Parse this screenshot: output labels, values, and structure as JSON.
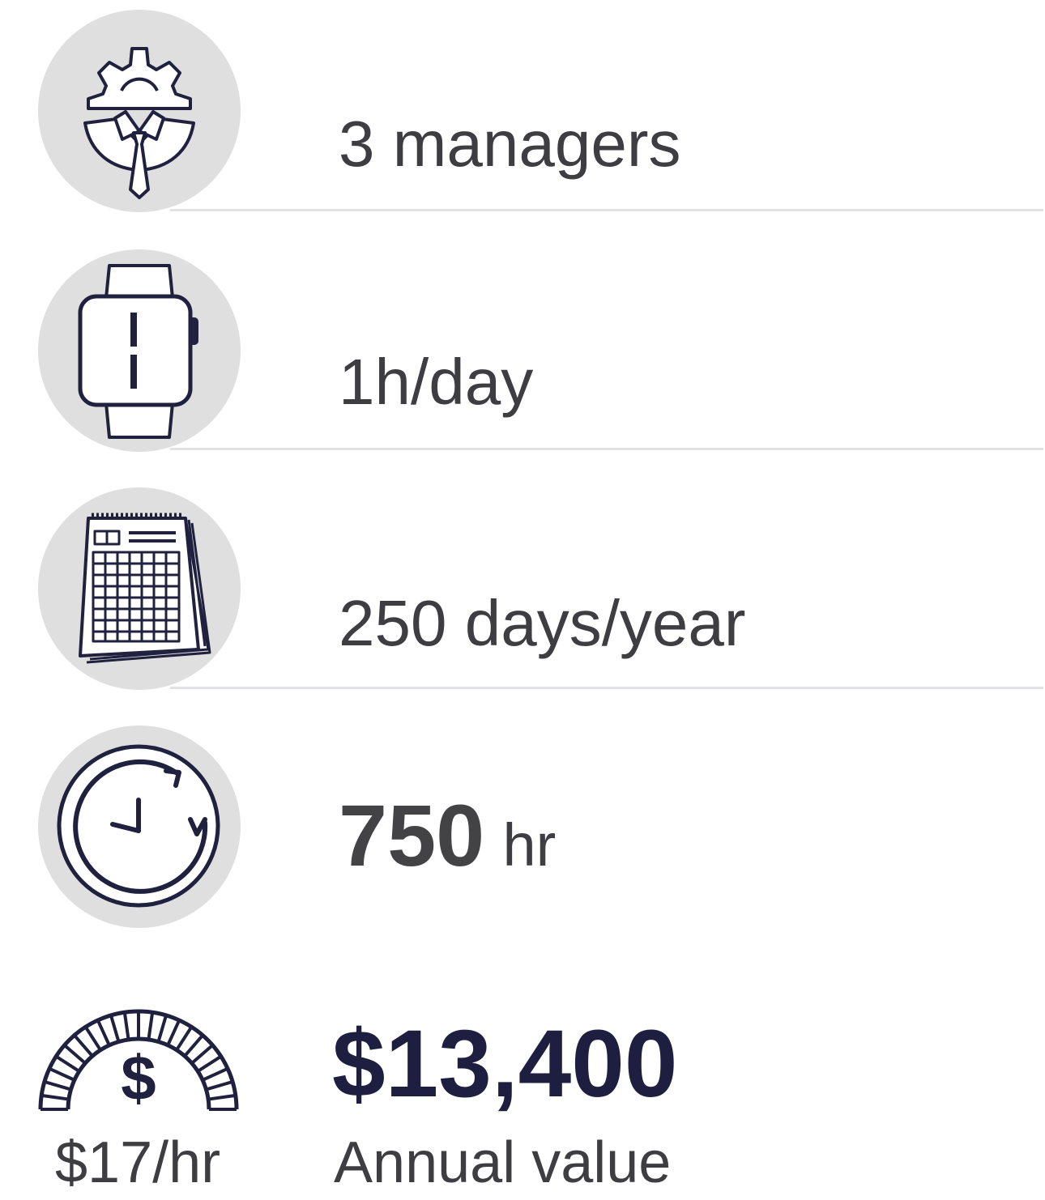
{
  "rows": [
    {
      "icon": "gear-manager-icon",
      "text": "3 managers"
    },
    {
      "icon": "smartwatch-icon",
      "text": "1h/day"
    },
    {
      "icon": "calendar-icon",
      "text": "250 days/year"
    }
  ],
  "total_hours": {
    "icon": "clock-refresh-icon",
    "value": "750",
    "unit": "hr"
  },
  "annual": {
    "icon": "dollar-gauge-icon",
    "rate": "$17/hr",
    "value": "$13,400",
    "label": "Annual value"
  },
  "colors": {
    "icon_stroke": "#20203f",
    "circle_bg": "#dfdfe0",
    "text": "#3e3e42",
    "accent_value": "#1e1e40"
  }
}
